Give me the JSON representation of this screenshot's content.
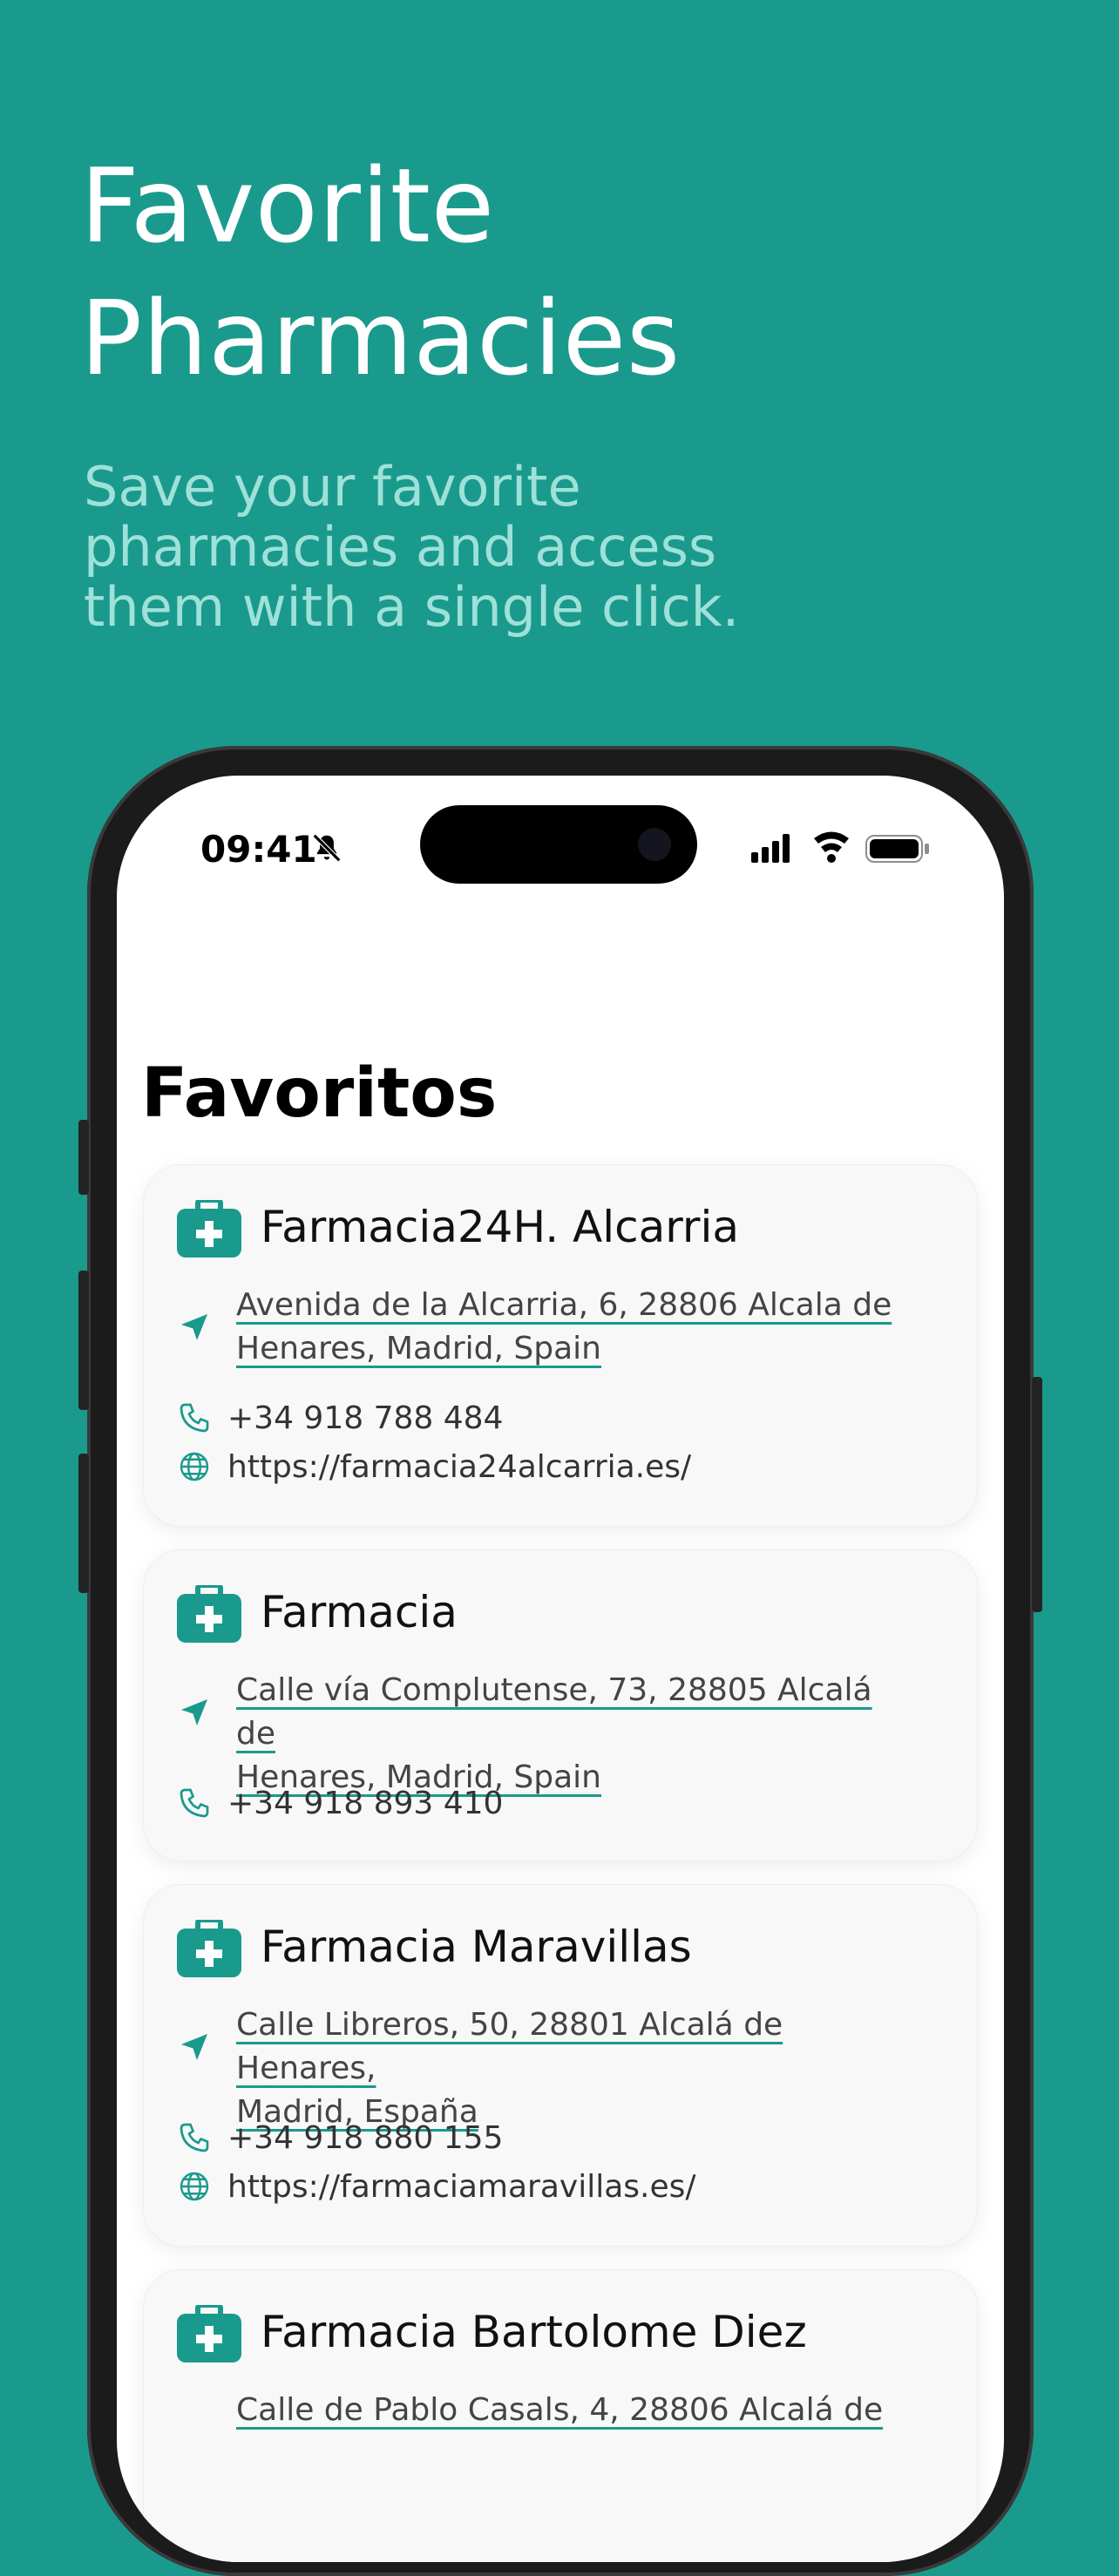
{
  "hero": {
    "title_line1": "Favorite",
    "title_line2": "Pharmacies",
    "subtitle_line1": "Save your favorite",
    "subtitle_line2": "pharmacies and access",
    "subtitle_line3": "them with a single click."
  },
  "status_bar": {
    "time": "09:41"
  },
  "screen": {
    "title": "Favoritos"
  },
  "pharmacies": [
    {
      "name": "Farmacia24H. Alcarria",
      "address_line1": "Avenida de la Alcarria, 6, 28806 Alcala de",
      "address_line2": "Henares, Madrid, Spain",
      "phone": "+34 918 788 484",
      "website": "https://farmacia24alcarria.es/"
    },
    {
      "name": "Farmacia",
      "address_line1": "Calle vía Complutense, 73, 28805 Alcalá de",
      "address_line2": "Henares, Madrid, Spain",
      "phone": "+34 918 893 410"
    },
    {
      "name": "Farmacia Maravillas",
      "address_line1": "Calle Libreros, 50, 28801 Alcalá de Henares,",
      "address_line2": "Madrid, España",
      "phone": "+34 918 880 155",
      "website": "https://farmaciamaravillas.es/"
    },
    {
      "name": "Farmacia Bartolome Diez",
      "address_line1": "Calle de Pablo Casals, 4, 28806 Alcalá de"
    }
  ],
  "colors": {
    "background": "#1a9a8c",
    "accent": "#1a9a8c",
    "subtitle": "#9ee1d8"
  }
}
